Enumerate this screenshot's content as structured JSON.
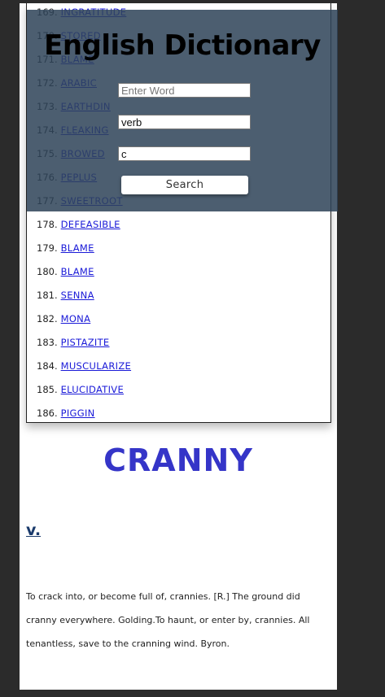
{
  "app": {
    "title": "English Dictionary"
  },
  "word_list": {
    "items": [
      {
        "num": "169.",
        "word": "INGRATITUDE"
      },
      {
        "num": "170.",
        "word": "STORED"
      },
      {
        "num": "171.",
        "word": "BLAME"
      },
      {
        "num": "172.",
        "word": "ARABIC"
      },
      {
        "num": "173.",
        "word": "EARTHDIN"
      },
      {
        "num": "174.",
        "word": "FLEAKING"
      },
      {
        "num": "175.",
        "word": "BROWED"
      },
      {
        "num": "176.",
        "word": "PEPLUS"
      },
      {
        "num": "177.",
        "word": "SWEETROOT"
      },
      {
        "num": "178.",
        "word": "DEFEASIBLE"
      },
      {
        "num": "179.",
        "word": "BLAME"
      },
      {
        "num": "180.",
        "word": "BLAME"
      },
      {
        "num": "181.",
        "word": "SENNA"
      },
      {
        "num": "182.",
        "word": "MONA"
      },
      {
        "num": "183.",
        "word": "PISTAZITE"
      },
      {
        "num": "184.",
        "word": "MUSCULARIZE"
      },
      {
        "num": "185.",
        "word": "ELUCIDATIVE"
      },
      {
        "num": "186.",
        "word": "PIGGIN"
      }
    ]
  },
  "search": {
    "word_placeholder": "Enter Word",
    "pos_value": "verb",
    "letter_value": "c",
    "button_label": "Search"
  },
  "result": {
    "headword": "CRANNY",
    "part_of_speech": "v.",
    "definition": "To crack into, or become full of, crannies. [R.] The ground did cranny everywhere. Golding.To haunt, or enter by, crannies. All tenantless, save to the cranning wind. Byron."
  }
}
